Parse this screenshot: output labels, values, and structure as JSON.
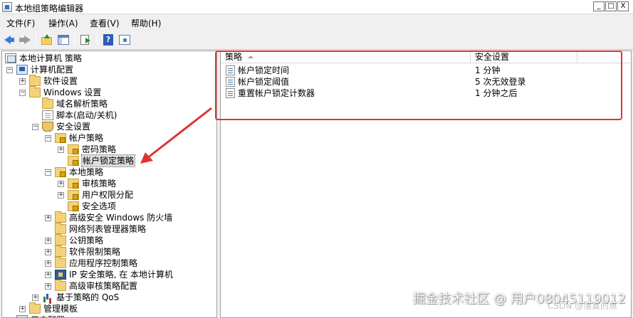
{
  "window": {
    "title": "本地组策略编辑器",
    "buttons": {
      "minimize": "_",
      "maximize": "□",
      "close": "X"
    }
  },
  "menu": {
    "items": [
      "文件(F)",
      "操作(A)",
      "查看(V)",
      "帮助(H)"
    ]
  },
  "toolbar": {
    "icons": [
      "back-arrow-icon",
      "forward-arrow-icon",
      "up-folder-icon",
      "show-hide-tree-icon",
      "export-list-icon",
      "help-icon",
      "properties-icon"
    ]
  },
  "tree": {
    "items": [
      {
        "label": "本地计算机 策略",
        "expander": ""
      },
      {
        "label": "计算机配置",
        "expander": "⊟"
      },
      {
        "label": "软件设置",
        "expander": "⊞"
      },
      {
        "label": "Windows 设置",
        "expander": "⊟"
      },
      {
        "label": "域名解析策略",
        "expander": ""
      },
      {
        "label": "脚本(启动/关机)",
        "expander": ""
      },
      {
        "label": "安全设置",
        "expander": "⊟"
      },
      {
        "label": "帐户策略",
        "expander": "⊟"
      },
      {
        "label": "密码策略",
        "expander": "⊞"
      },
      {
        "label": "帐户锁定策略",
        "expander": ""
      },
      {
        "label": "本地策略",
        "expander": "⊟"
      },
      {
        "label": "审核策略",
        "expander": "⊞"
      },
      {
        "label": "用户权限分配",
        "expander": "⊞"
      },
      {
        "label": "安全选项",
        "expander": ""
      },
      {
        "label": "高级安全 Windows 防火墙",
        "expander": "⊞"
      },
      {
        "label": "网络列表管理器策略",
        "expander": ""
      },
      {
        "label": "公钥策略",
        "expander": "⊞"
      },
      {
        "label": "软件限制策略",
        "expander": "⊞"
      },
      {
        "label": "应用程序控制策略",
        "expander": "⊞"
      },
      {
        "label": "IP 安全策略, 在 本地计算机",
        "expander": "⊞"
      },
      {
        "label": "高级审核策略配置",
        "expander": "⊞"
      },
      {
        "label": "基于策略的 QoS",
        "expander": "⊞"
      },
      {
        "label": "管理模板",
        "expander": "⊞"
      },
      {
        "label": "用户配置",
        "expander": "⊟"
      }
    ],
    "selected": "帐户锁定策略"
  },
  "list": {
    "columns": [
      "策略",
      "安全设置"
    ],
    "rows": [
      {
        "policy": "帐户锁定时间",
        "setting": "1 分钟"
      },
      {
        "policy": "帐户锁定阈值",
        "setting": "5 次无效登录"
      },
      {
        "policy": "重置帐户锁定计数器",
        "setting": "1 分钟之后"
      }
    ]
  },
  "annotation": {
    "highlight_color": "#e03434"
  },
  "watermark": {
    "text": "掘金技术社区 @ 用户08045119012",
    "sub": "CSDN @落寞的魚"
  }
}
